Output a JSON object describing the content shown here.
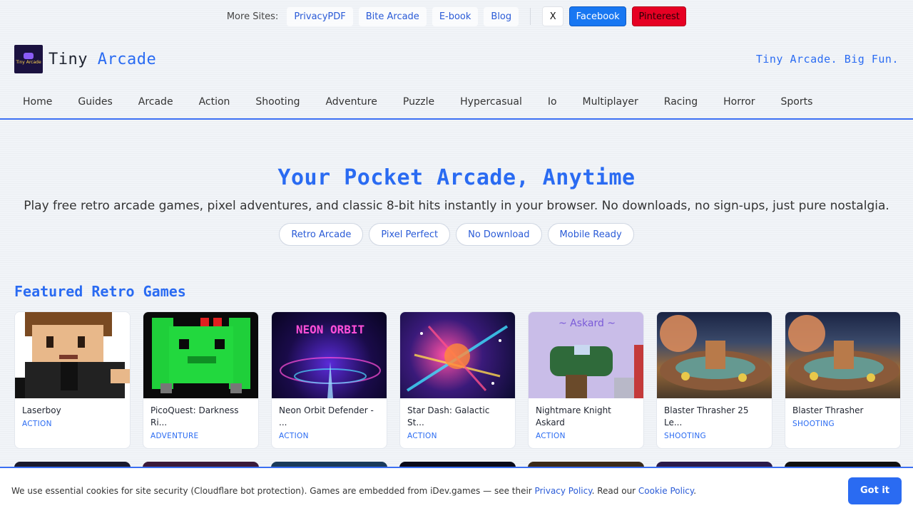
{
  "topbar": {
    "label": "More Sites:",
    "links": [
      "PrivacyPDF",
      "Bite Arcade",
      "E-book",
      "Blog"
    ],
    "social": {
      "x": "X",
      "facebook": "Facebook",
      "pinterest": "Pinterest"
    }
  },
  "header": {
    "brand_plain": "Tiny",
    "brand_accent": "Arcade",
    "logo_text": "Tiny Arcade",
    "tagline": "Tiny Arcade. Big Fun."
  },
  "nav": [
    "Home",
    "Guides",
    "Arcade",
    "Action",
    "Shooting",
    "Adventure",
    "Puzzle",
    "Hypercasual",
    "Io",
    "Multiplayer",
    "Racing",
    "Horror",
    "Sports"
  ],
  "hero": {
    "title": "Your Pocket Arcade, Anytime",
    "subtitle": "Play free retro arcade games, pixel adventures, and classic 8-bit hits instantly in your browser. No downloads, no sign-ups, just pure nostalgia.",
    "pills": [
      "Retro Arcade",
      "Pixel Perfect",
      "No Download",
      "Mobile Ready"
    ]
  },
  "featured": {
    "title": "Featured Retro Games",
    "games": [
      {
        "title": "Laserboy",
        "category": "ACTION"
      },
      {
        "title": "PicoQuest: Darkness Ri...",
        "category": "ADVENTURE"
      },
      {
        "title": "Neon Orbit Defender - ...",
        "category": "ACTION",
        "thumb_text": "NEON ORBIT"
      },
      {
        "title": "Star Dash: Galactic St...",
        "category": "ACTION"
      },
      {
        "title": "Nightmare Knight Askard",
        "category": "ACTION",
        "thumb_text": "~ Askard ~"
      },
      {
        "title": "Blaster Thrasher 25 Le...",
        "category": "SHOOTING"
      },
      {
        "title": "Blaster Thrasher",
        "category": "SHOOTING"
      }
    ]
  },
  "cookie": {
    "text_before": "We use essential cookies for site security (Cloudflare bot protection). Games are embedded from iDev.games — see their ",
    "privacy_link": "Privacy Policy",
    "text_middle": ". Read our ",
    "cookie_link": "Cookie Policy",
    "text_after": ".",
    "button": "Got it"
  }
}
